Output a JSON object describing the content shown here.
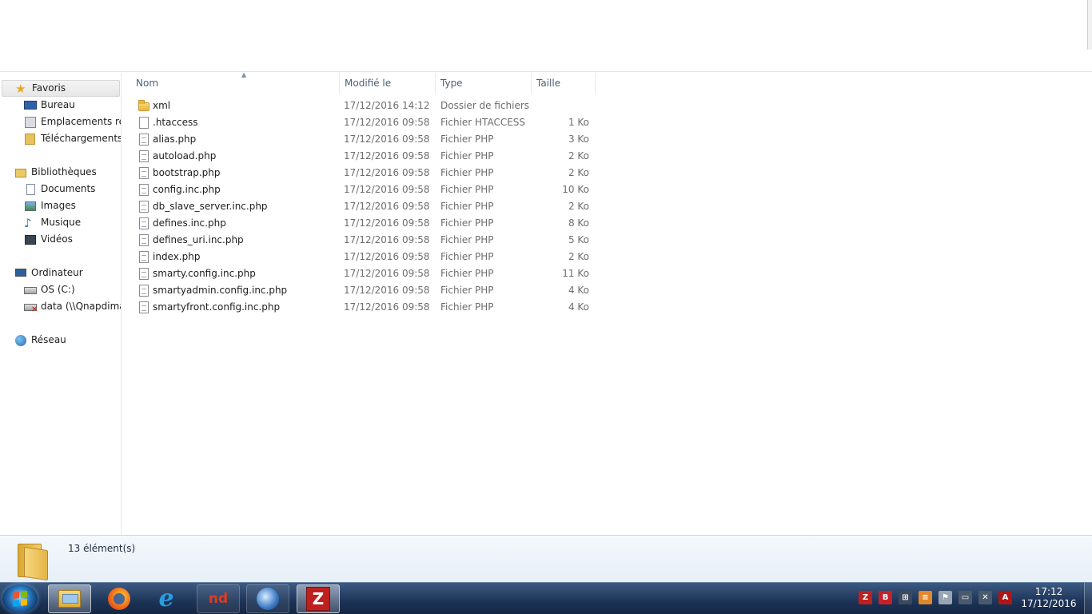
{
  "nav": {
    "favorites": "Favoris",
    "desktop": "Bureau",
    "recent_places": "Emplacements réc",
    "downloads": "Téléchargements",
    "libraries": "Bibliothèques",
    "documents": "Documents",
    "images": "Images",
    "music": "Musique",
    "videos": "Vidéos",
    "computer": "Ordinateur",
    "drive_c": "OS (C:)",
    "network_drive": "data (\\\\Qnapdimar",
    "network": "Réseau"
  },
  "columns": {
    "name": "Nom",
    "modified": "Modifié le",
    "type": "Type",
    "size": "Taille"
  },
  "files": [
    {
      "name": "xml",
      "modified": "17/12/2016 14:12",
      "type": "Dossier de fichiers",
      "size": "",
      "icon": "folder-icon"
    },
    {
      "name": ".htaccess",
      "modified": "17/12/2016 09:58",
      "type": "Fichier HTACCESS",
      "size": "1 Ko",
      "icon": "file-icon"
    },
    {
      "name": "alias.php",
      "modified": "17/12/2016 09:58",
      "type": "Fichier PHP",
      "size": "3 Ko",
      "icon": "php-file-icon"
    },
    {
      "name": "autoload.php",
      "modified": "17/12/2016 09:58",
      "type": "Fichier PHP",
      "size": "2 Ko",
      "icon": "php-file-icon"
    },
    {
      "name": "bootstrap.php",
      "modified": "17/12/2016 09:58",
      "type": "Fichier PHP",
      "size": "2 Ko",
      "icon": "php-file-icon"
    },
    {
      "name": "config.inc.php",
      "modified": "17/12/2016 09:58",
      "type": "Fichier PHP",
      "size": "10 Ko",
      "icon": "php-file-icon"
    },
    {
      "name": "db_slave_server.inc.php",
      "modified": "17/12/2016 09:58",
      "type": "Fichier PHP",
      "size": "2 Ko",
      "icon": "php-file-icon"
    },
    {
      "name": "defines.inc.php",
      "modified": "17/12/2016 09:58",
      "type": "Fichier PHP",
      "size": "8 Ko",
      "icon": "php-file-icon"
    },
    {
      "name": "defines_uri.inc.php",
      "modified": "17/12/2016 09:58",
      "type": "Fichier PHP",
      "size": "5 Ko",
      "icon": "php-file-icon"
    },
    {
      "name": "index.php",
      "modified": "17/12/2016 09:58",
      "type": "Fichier PHP",
      "size": "2 Ko",
      "icon": "php-file-icon"
    },
    {
      "name": "smarty.config.inc.php",
      "modified": "17/12/2016 09:58",
      "type": "Fichier PHP",
      "size": "11 Ko",
      "icon": "php-file-icon"
    },
    {
      "name": "smartyadmin.config.inc.php",
      "modified": "17/12/2016 09:58",
      "type": "Fichier PHP",
      "size": "4 Ko",
      "icon": "php-file-icon"
    },
    {
      "name": "smartyfront.config.inc.php",
      "modified": "17/12/2016 09:58",
      "type": "Fichier PHP",
      "size": "4 Ko",
      "icon": "php-file-icon"
    }
  ],
  "details": {
    "item_count": "13 élément(s)"
  },
  "taskbar": {
    "apps": [
      "windows-explorer-icon",
      "firefox-icon",
      "internet-explorer-icon",
      "nd-app-icon",
      "thunderbird-icon",
      "filezilla-icon"
    ],
    "nd_label": "nd",
    "fz_label": "Z",
    "time": "17:12",
    "date": "17/12/2016"
  },
  "colors": {
    "header_text": "#4c607a",
    "secondary_text": "#6d6d6d",
    "taskbar": "#1d3457"
  }
}
